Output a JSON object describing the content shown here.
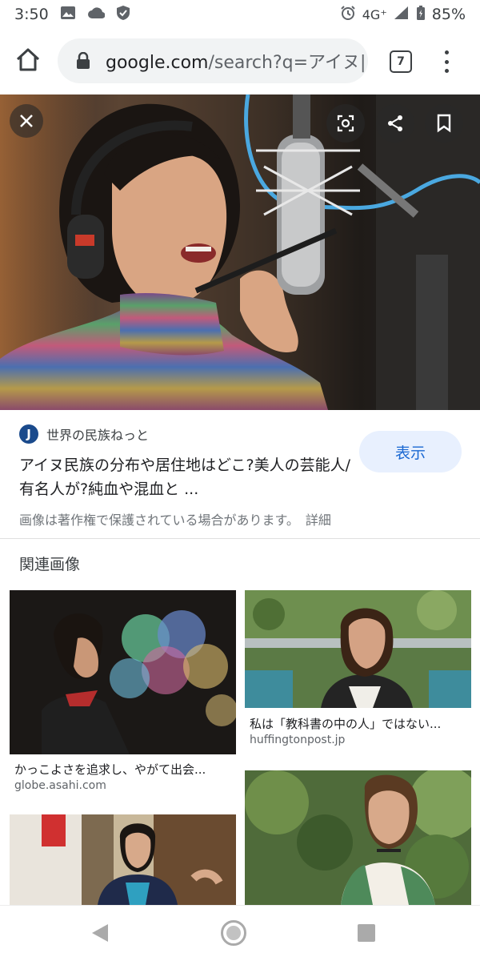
{
  "status_bar": {
    "time": "3:50",
    "network": "4G⁺",
    "battery": "85%",
    "icons": [
      "image-icon",
      "cloud-icon",
      "shield-icon",
      "alarm-icon",
      "signal-icon",
      "battery-icon"
    ]
  },
  "browser": {
    "url_host": "google.com",
    "url_path": "/search?q=アイヌ|",
    "tab_count": "7",
    "icons": [
      "home-icon",
      "lock-icon",
      "more-vert-icon"
    ]
  },
  "hero": {
    "description_icons": [
      "close-icon",
      "lens-icon",
      "share-icon",
      "bookmark-icon"
    ]
  },
  "result": {
    "source_logo_letter": "J",
    "source_name": "世界の民族ねっと",
    "title": "アイヌ民族の分布や居住地はどこ?美人の芸能人/有名人が?純血や混血と ...",
    "view_label": "表示",
    "copyright": "画像は著作権で保護されている場合があります。",
    "details_label": "詳細"
  },
  "related": {
    "heading": "関連画像",
    "items": [
      {
        "caption": "かっこよさを追求し、やがて出会...",
        "source": "globe.asahi.com"
      },
      {
        "caption": "私は「教科書の中の人」ではない...",
        "source": "huffingtonpost.jp"
      },
      {
        "caption": "",
        "source": ""
      },
      {
        "caption": "",
        "source": ""
      }
    ]
  },
  "nav_bar": {
    "icons": [
      "back-icon",
      "home-circle-icon",
      "recents-icon"
    ]
  },
  "colors": {
    "accent": "#1967d2",
    "view_button_bg": "#e8f0fe",
    "url_pill_bg": "#f1f3f4"
  }
}
